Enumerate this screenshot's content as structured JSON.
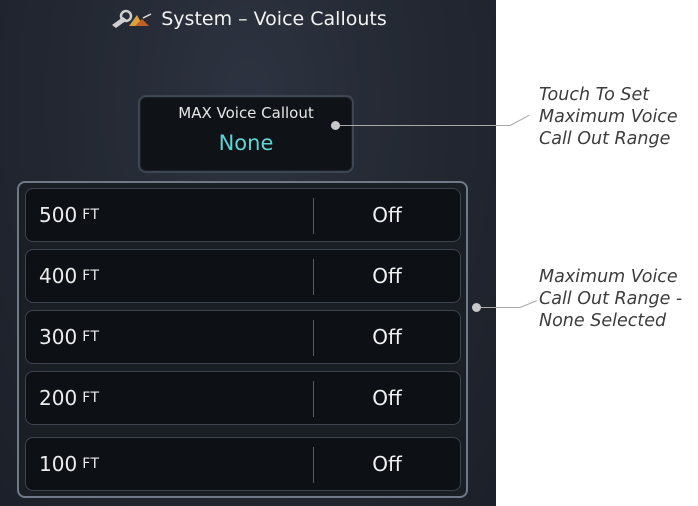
{
  "header": {
    "title": "System – Voice Callouts",
    "icon": "wrench-icon"
  },
  "max_voice_callout": {
    "label": "MAX Voice Callout",
    "value": "None",
    "value_color": "#5fd4d4"
  },
  "rows": [
    {
      "altitude": "500",
      "unit": "FT",
      "state": "Off"
    },
    {
      "altitude": "400",
      "unit": "FT",
      "state": "Off"
    },
    {
      "altitude": "300",
      "unit": "FT",
      "state": "Off"
    },
    {
      "altitude": "200",
      "unit": "FT",
      "state": "Off"
    },
    {
      "altitude": "100",
      "unit": "FT",
      "state": "Off"
    }
  ],
  "annotations": {
    "touch_to_set": [
      "Touch To Set",
      "Maximum Voice",
      "Call Out Range"
    ],
    "none_selected": [
      "Maximum Voice",
      "Call Out Range -",
      "None Selected"
    ]
  }
}
